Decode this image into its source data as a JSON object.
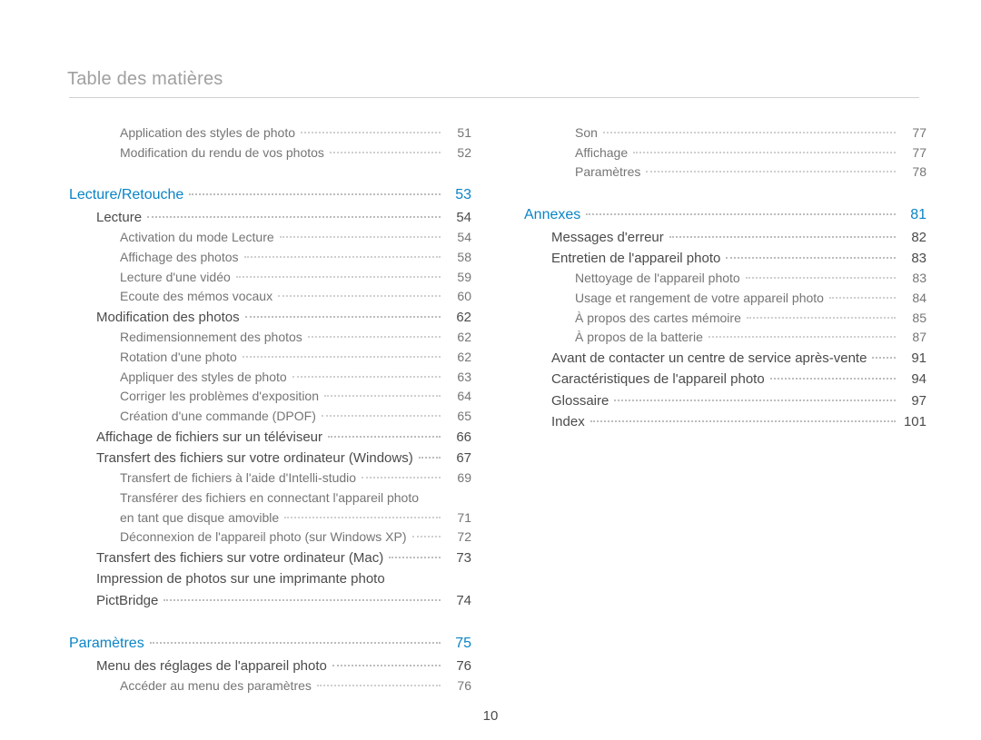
{
  "running_head": "Table des matières",
  "page_number": "10",
  "columns": [
    [
      {
        "level": 2,
        "label": "Application des styles de photo",
        "page": "51"
      },
      {
        "level": 2,
        "label": "Modification du rendu de vos photos",
        "page": "52"
      },
      {
        "spacer": true
      },
      {
        "level": 0,
        "label": "Lecture/Retouche",
        "page": "53"
      },
      {
        "level": 1,
        "label": "Lecture",
        "page": "54"
      },
      {
        "level": 2,
        "label": "Activation du mode Lecture",
        "page": "54"
      },
      {
        "level": 2,
        "label": "Affichage des photos",
        "page": "58"
      },
      {
        "level": 2,
        "label": "Lecture d'une vidéo",
        "page": "59"
      },
      {
        "level": 2,
        "label": "Ecoute des mémos vocaux",
        "page": "60"
      },
      {
        "level": 1,
        "label": "Modification des photos",
        "page": "62"
      },
      {
        "level": 2,
        "label": "Redimensionnement des photos",
        "page": "62"
      },
      {
        "level": 2,
        "label": "Rotation d'une photo",
        "page": "62"
      },
      {
        "level": 2,
        "label": "Appliquer des styles de photo",
        "page": "63"
      },
      {
        "level": 2,
        "label": "Corriger les problèmes d'exposition",
        "page": "64"
      },
      {
        "level": 2,
        "label": "Création d'une commande (DPOF)",
        "page": "65"
      },
      {
        "level": 1,
        "label": "Affichage de fichiers sur un téléviseur",
        "page": "66"
      },
      {
        "level": 1,
        "label": "Transfert des fichiers sur votre ordinateur (Windows)",
        "page": "67"
      },
      {
        "level": 2,
        "label": "Transfert de fichiers à l'aide d'Intelli-studio",
        "page": "69"
      },
      {
        "level": 2,
        "label": "Transférer des fichiers en connectant l'appareil photo",
        "continued": true
      },
      {
        "level": 2,
        "label": "en tant que disque amovible",
        "page": "71"
      },
      {
        "level": 2,
        "label": "Déconnexion de l'appareil photo (sur Windows XP)",
        "page": "72"
      },
      {
        "level": 1,
        "label": "Transfert des fichiers sur votre ordinateur (Mac)",
        "page": "73"
      },
      {
        "level": 1,
        "label": "Impression de photos sur une imprimante photo",
        "continued": true
      },
      {
        "level": 1,
        "label": "PictBridge",
        "page": "74"
      },
      {
        "spacer": true
      },
      {
        "level": 0,
        "label": "Paramètres",
        "page": "75"
      },
      {
        "level": 1,
        "label": "Menu des réglages de l'appareil photo",
        "page": "76"
      },
      {
        "level": 2,
        "label": "Accéder au menu des paramètres",
        "page": "76"
      }
    ],
    [
      {
        "level": 2,
        "label": "Son",
        "page": "77"
      },
      {
        "level": 2,
        "label": "Affichage",
        "page": "77"
      },
      {
        "level": 2,
        "label": "Paramètres",
        "page": "78"
      },
      {
        "spacer": true
      },
      {
        "level": 0,
        "label": "Annexes",
        "page": "81"
      },
      {
        "level": 1,
        "label": "Messages d'erreur",
        "page": "82"
      },
      {
        "level": 1,
        "label": "Entretien de l'appareil photo",
        "page": "83"
      },
      {
        "level": 2,
        "label": "Nettoyage de l'appareil photo",
        "page": "83"
      },
      {
        "level": 2,
        "label": "Usage et rangement de votre appareil photo",
        "page": "84"
      },
      {
        "level": 2,
        "label": "À propos des cartes mémoire",
        "page": "85"
      },
      {
        "level": 2,
        "label": "À propos de la batterie",
        "page": "87"
      },
      {
        "level": 1,
        "label": "Avant de contacter un centre de service après-vente",
        "page": "91"
      },
      {
        "level": 1,
        "label": "Caractéristiques de l'appareil photo",
        "page": "94"
      },
      {
        "level": 1,
        "label": "Glossaire",
        "page": "97"
      },
      {
        "level": 1,
        "label": "Index",
        "page": "101"
      }
    ]
  ]
}
